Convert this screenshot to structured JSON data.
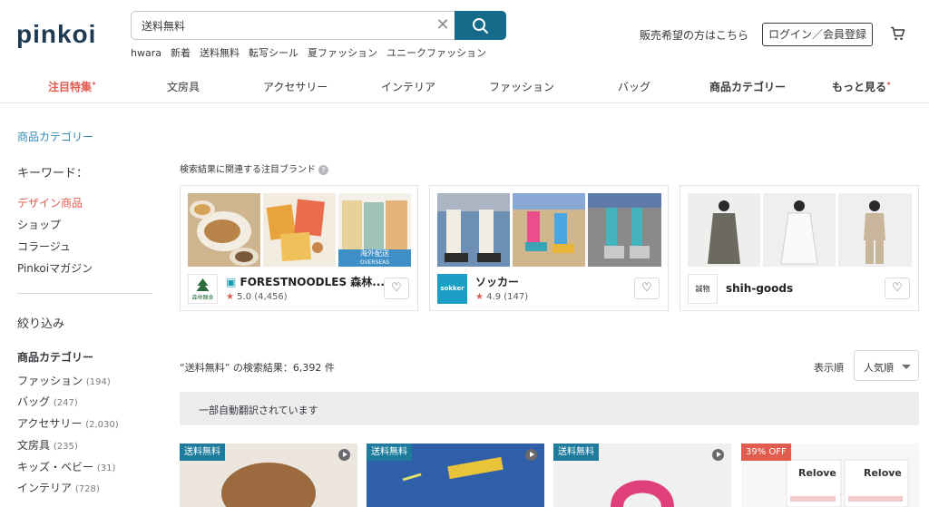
{
  "header": {
    "logo": "pinkoi",
    "search_value": "送料無料",
    "suggestions": [
      "hwara",
      "新着",
      "送料無料",
      "転写シール",
      "夏ファッション",
      "ユニークファッション"
    ],
    "seller_link": "販売希望の方はこちら",
    "login_button": "ログイン／会員登録"
  },
  "nav": {
    "items": [
      "注目特集",
      "文房具",
      "アクセサリー",
      "インテリア",
      "ファッション",
      "バッグ",
      "商品カテゴリー",
      "もっと見る"
    ],
    "star": "•"
  },
  "sidebar": {
    "category_link": "商品カテゴリー",
    "keyword_label": "キーワード：",
    "keyword_items": [
      "デザイン商品",
      "ショップ",
      "コラージュ",
      "Pinkoiマガジン"
    ],
    "filter_label": "絞り込み",
    "category_heading": "商品カテゴリー",
    "categories": [
      {
        "name": "ファッション",
        "count": "(194)"
      },
      {
        "name": "バッグ",
        "count": "(247)"
      },
      {
        "name": "アクセサリー",
        "count": "(2,030)"
      },
      {
        "name": "文房具",
        "count": "(235)"
      },
      {
        "name": "キッズ・ベビー",
        "count": "(31)"
      },
      {
        "name": "インテリア",
        "count": "(728)"
      }
    ]
  },
  "brands": {
    "heading": "検索結果に関連する注目ブランド",
    "question_mark": "?",
    "cards": [
      {
        "name": "FORESTNOODLES 森林...",
        "rating": "5.0",
        "reviews": "(4,456)",
        "badge_text": "海外配送",
        "badge_sub": "OVERSEAS",
        "logo_text": "森林麵食"
      },
      {
        "name": "ソッカー",
        "rating": "4.9",
        "reviews": "(147)",
        "logo_text": "sokker"
      },
      {
        "name": "shih-goods",
        "rating": "",
        "reviews": "",
        "logo_text": "誠物"
      }
    ],
    "star": "★",
    "heart": "♡"
  },
  "results": {
    "summary": "“送料無料” の検索結果：6,392 件",
    "sort_label": "表示順",
    "sort_value": "人気順",
    "notice": "一部自動翻訳されています"
  },
  "products": [
    {
      "badge": "送料無料"
    },
    {
      "badge": "送料無料"
    },
    {
      "badge": "送料無料"
    },
    {
      "badge": "39% OFF",
      "brand": "Relove"
    }
  ],
  "colors": {
    "accent_blue": "#176b8a",
    "highlight_red": "#e15b4f",
    "link_blue": "#2f8ab0"
  }
}
